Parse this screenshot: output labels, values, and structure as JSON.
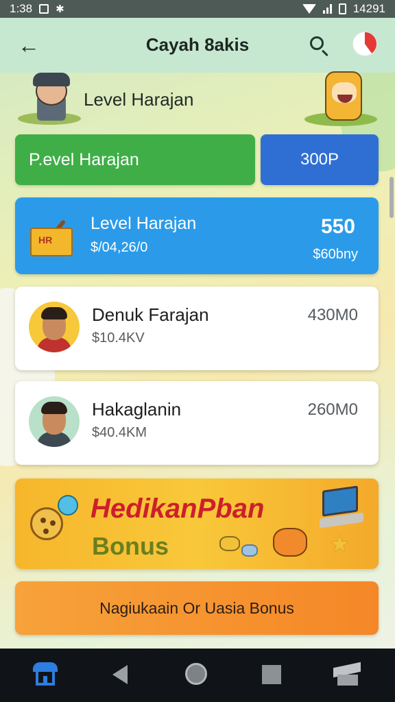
{
  "status_bar": {
    "time_left": "1:38",
    "time_right": "14291"
  },
  "app_bar": {
    "back_icon": "arrow-left-icon",
    "title": "Cayah 8akis",
    "search_icon": "search-icon"
  },
  "header": {
    "level_label": "Level Harajan"
  },
  "buttons": {
    "green_label": "P.evel Harajan",
    "blue_label": "300P"
  },
  "featured_card": {
    "box_label": "HR",
    "title": "Level Harajan",
    "subtitle": "$/04,26/0",
    "value": "550",
    "value_sub": "$60bny"
  },
  "players": [
    {
      "name": "Denuk Farajan",
      "amount": "$10.4KV",
      "score": "430M0"
    },
    {
      "name": "Hakaglanin",
      "amount": "$40.4KM",
      "score": "260M0"
    }
  ],
  "banner": {
    "title": "HedikanPban",
    "bonus": "Bonus"
  },
  "bottom_button": {
    "label": "Nagiukaain Or Uasia Bonus"
  },
  "nav_bar": {
    "items": [
      "home-icon",
      "back-triangle-icon",
      "home-circle-icon",
      "recents-square-icon",
      "graduation-cap-icon"
    ]
  },
  "colors": {
    "green": "#3fae47",
    "blue": "#2f6fd4",
    "card_blue": "#2b9be9",
    "orange": "#f58727",
    "banner_red": "#cc1f2b"
  }
}
